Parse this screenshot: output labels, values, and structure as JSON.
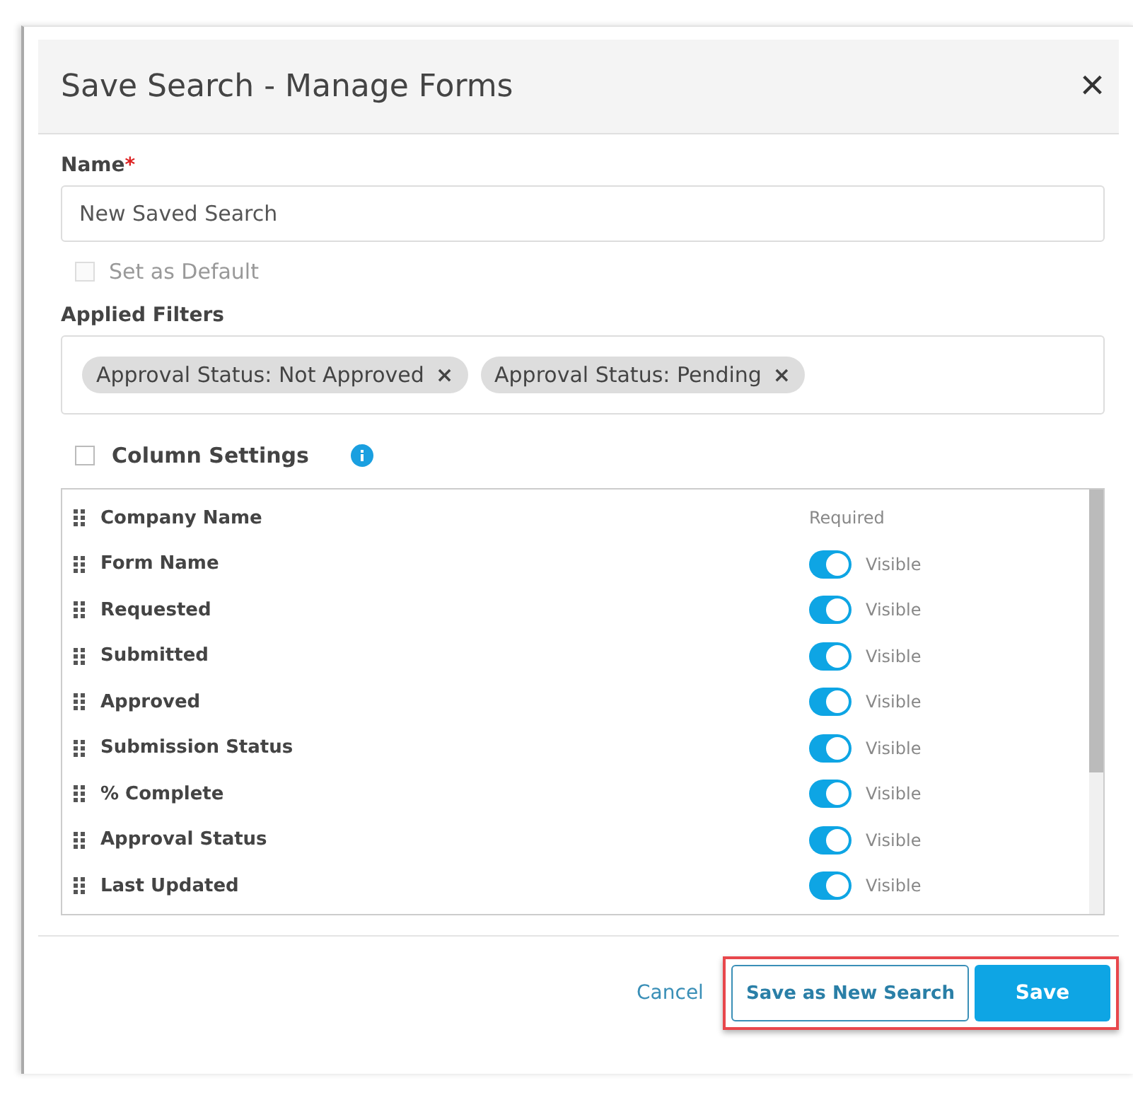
{
  "dialog": {
    "title": "Save Search - Manage Forms",
    "close": "×"
  },
  "name_field": {
    "label": "Name",
    "required_mark": "*",
    "value": "New Saved Search"
  },
  "set_default": {
    "label": "Set as Default",
    "checked": false,
    "disabled": true
  },
  "applied_filters": {
    "label": "Applied Filters",
    "chips": [
      {
        "label": "Approval Status: Not Approved",
        "remove": "×"
      },
      {
        "label": "Approval Status: Pending",
        "remove": "×"
      }
    ]
  },
  "column_settings": {
    "label": "Column Settings",
    "checked": false,
    "columns": [
      {
        "name": "Company Name",
        "kind": "required",
        "status": "Required"
      },
      {
        "name": "Form Name",
        "kind": "toggle",
        "on": true,
        "status": "Visible"
      },
      {
        "name": "Requested",
        "kind": "toggle",
        "on": true,
        "status": "Visible"
      },
      {
        "name": "Submitted",
        "kind": "toggle",
        "on": true,
        "status": "Visible"
      },
      {
        "name": "Approved",
        "kind": "toggle",
        "on": true,
        "status": "Visible"
      },
      {
        "name": "Submission Status",
        "kind": "toggle",
        "on": true,
        "status": "Visible"
      },
      {
        "name": "% Complete",
        "kind": "toggle",
        "on": true,
        "status": "Visible"
      },
      {
        "name": "Approval Status",
        "kind": "toggle",
        "on": true,
        "status": "Visible"
      },
      {
        "name": "Last Updated",
        "kind": "toggle",
        "on": true,
        "status": "Visible"
      }
    ]
  },
  "footer": {
    "cancel": "Cancel",
    "save_as_new": "Save as New Search",
    "save": "Save",
    "highlighted": true
  }
}
